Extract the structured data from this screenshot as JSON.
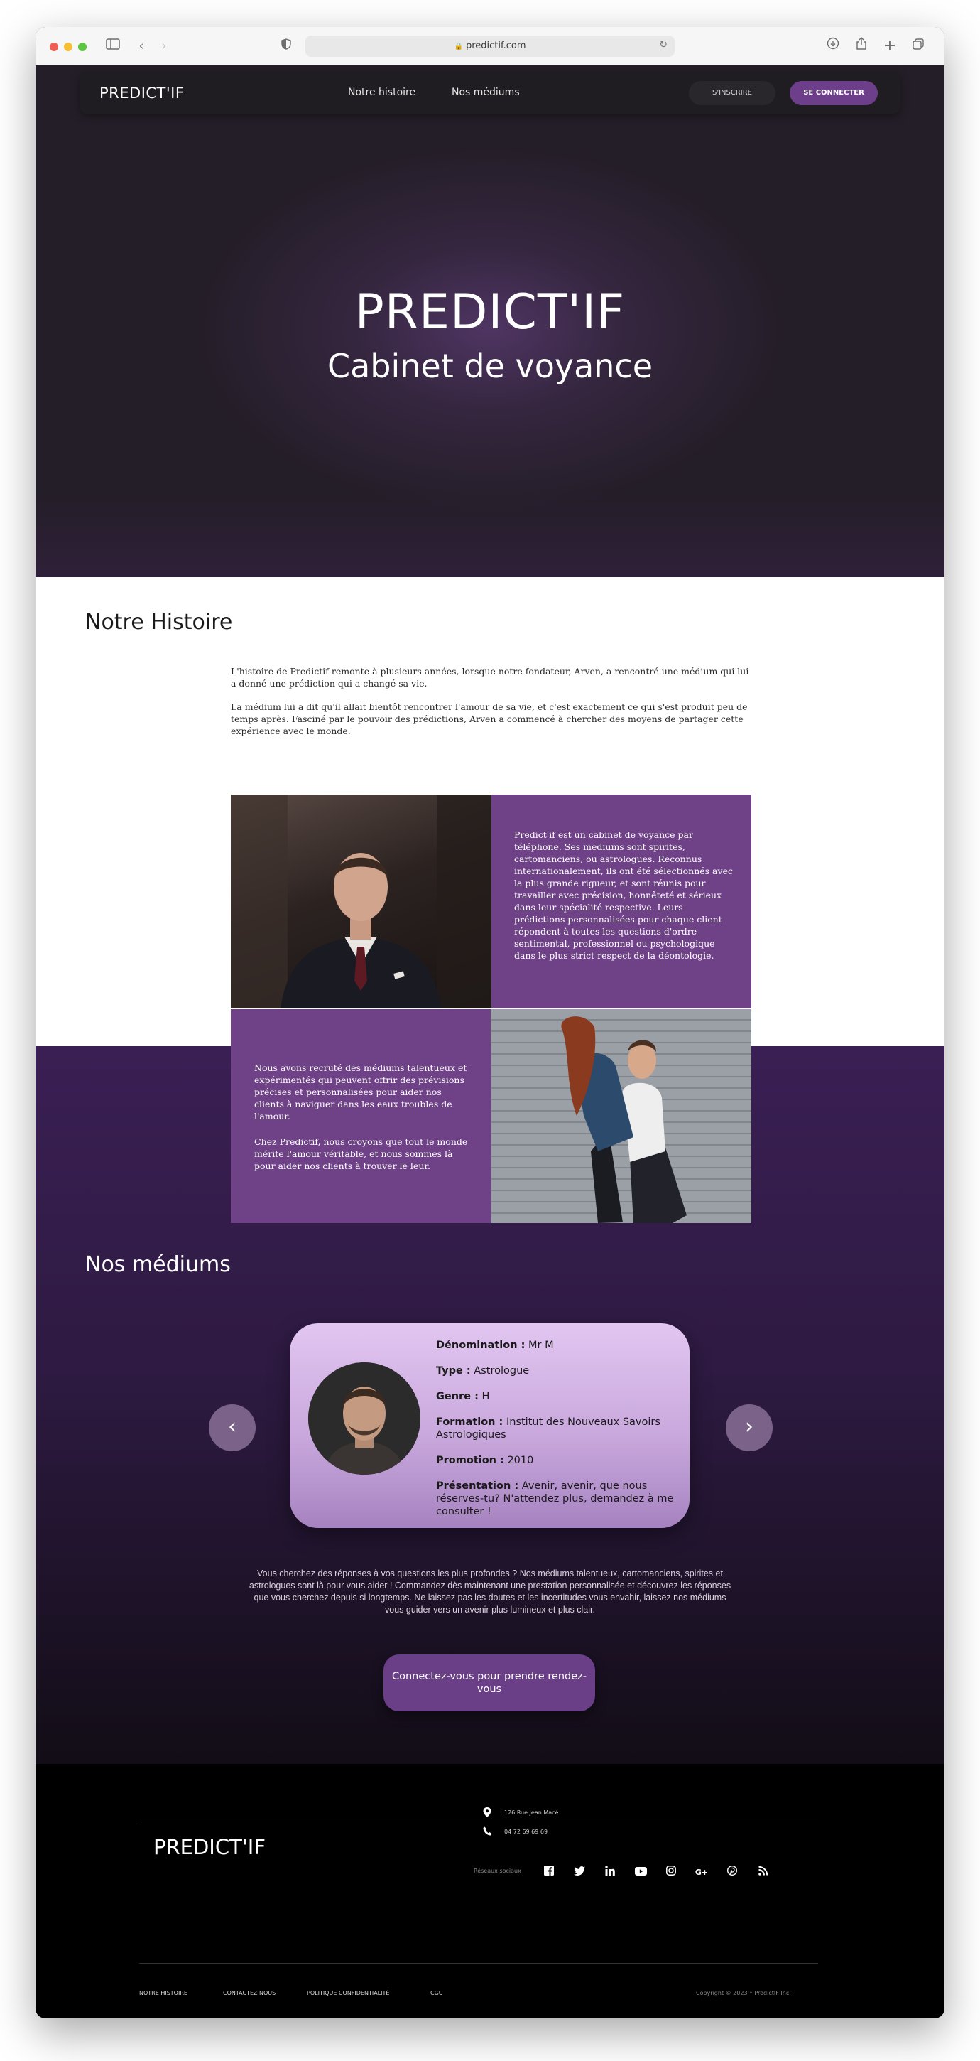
{
  "browser": {
    "url": "predictif.com"
  },
  "nav": {
    "brand": "PREDICT'IF",
    "links": [
      "Notre histoire",
      "Nos médiums"
    ],
    "register": "S'INSCRIRE",
    "login": "SE CONNECTER"
  },
  "hero": {
    "title": "PREDICT'IF",
    "subtitle": "Cabinet de voyance"
  },
  "story": {
    "title": "Notre Histoire",
    "paragraph1": "L'histoire de Predictif remonte à plusieurs années, lorsque notre fondateur, Arven, a rencontré une médium qui lui a donné une prédiction qui a changé sa vie.",
    "paragraph2": "La médium lui a dit qu'il allait bientôt rencontrer l'amour de sa vie, et c'est exactement ce qui s'est produit peu de temps après. Fasciné par le pouvoir des prédictions, Arven a commencé à chercher des moyens de partager cette expérience avec le monde.",
    "cell_text_1": "Predict'if est un cabinet de voyance par téléphone. Ses mediums sont spirites, cartomanciens, ou astrologues. Reconnus internationalement, ils ont été sélectionnés avec la plus grande rigueur, et sont réunis pour travailler avec précision, honnêteté et sérieux dans leur spécialité respective. Leurs prédictions personnalisées pour chaque client répondent à toutes les questions d'ordre sentimental, professionnel ou psychologique dans le plus strict respect de la déontologie.",
    "cell_text_2a": "Nous avons recruté des médiums talentueux et expérimentés qui peuvent offrir des prévisions précises et personnalisées pour aider nos clients à naviguer dans les eaux troubles de l'amour.",
    "cell_text_2b": "Chez Predictif, nous croyons que tout le monde mérite l'amour véritable, et nous sommes là pour aider nos clients à trouver le leur."
  },
  "mediums": {
    "title": "Nos médiums",
    "card": {
      "denomination_label": "Dénomination :",
      "denomination": "Mr M",
      "type_label": "Type :",
      "type": "Astrologue",
      "genre_label": "Genre :",
      "genre": "H",
      "formation_label": "Formation :",
      "formation": "Institut des Nouveaux Savoirs Astrologiques",
      "promotion_label": "Promotion :",
      "promotion": "2010",
      "presentation_label": "Présentation :",
      "presentation": "Avenir, avenir, que nous réserves-tu? N'attendez plus, demandez à me consulter !"
    },
    "prev_icon": "chevron-left-icon",
    "next_icon": "chevron-right-icon",
    "description": "Vous cherchez des réponses à vos questions les plus profondes ? Nos médiums talentueux, cartomanciens, spirites et astrologues sont là pour vous aider ! Commandez dès maintenant une prestation personnalisée et découvrez les réponses que vous cherchez depuis si longtemps. Ne laissez pas les doutes et les incertitudes vous envahir, laissez nos médiums vous guider vers un avenir plus lumineux et plus clair.",
    "cta": "Connectez-vous pour prendre rendez-vous"
  },
  "footer": {
    "brand": "PREDICT'IF",
    "address": "126 Rue Jean Macé",
    "phone": "04 72 69 69 69",
    "social_label": "Réseaux sociaux",
    "social_icons": [
      "facebook-icon",
      "twitter-icon",
      "linkedin-icon",
      "youtube-icon",
      "instagram-icon",
      "google-plus-icon",
      "pinterest-icon",
      "rss-icon"
    ],
    "links": [
      "NOTRE HISTOIRE",
      "CONTACTEZ NOUS",
      "POLITIQUE CONFIDENTIALITÉ",
      "CGU"
    ],
    "copyright": "Copyright © 2023 • PredictIF Inc."
  },
  "colors": {
    "accent": "#6d3f8a",
    "panel": "#6f4287",
    "hero_bg": "#241e28"
  }
}
